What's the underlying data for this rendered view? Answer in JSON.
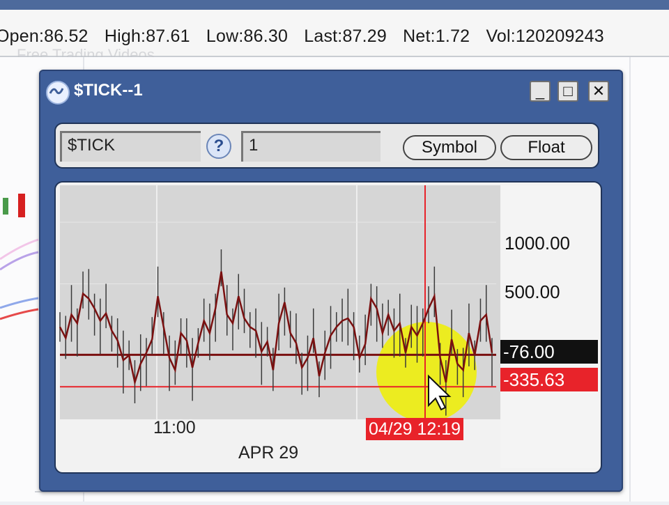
{
  "quote": {
    "open": "Open:86.52",
    "high": "High:87.61",
    "low": "Low:86.30",
    "last": "Last:87.29",
    "net": "Net:1.72",
    "vol": "Vol:120209243"
  },
  "watermark": "Free Trading Videos",
  "window": {
    "title": "$TICK--1",
    "min_label": "_",
    "max_label": "□",
    "close_label": "✕"
  },
  "toolbar": {
    "symbol_value": "$TICK",
    "help_label": "?",
    "interval_value": "1",
    "symbol_button": "Symbol",
    "float_button": "Float"
  },
  "chart": {
    "y_ticks": [
      "1000.00",
      "500.00"
    ],
    "last_tag": "-76.00",
    "crosshair_tag": "-335.63",
    "x_tick_1100": "11:00",
    "date_label": "APR 29",
    "crosshair_time": "04/29 12:19"
  },
  "colors": {
    "titlebar": "#3f5f9a",
    "price_line": "#7a1010",
    "crosshair": "#e8232a",
    "highlight": "#f0f000",
    "last_tag_bg": "#111111"
  },
  "chart_data": {
    "type": "line",
    "title": "$TICK",
    "xlabel": "",
    "ylabel": "",
    "ylim": [
      -600,
      1300
    ],
    "x_labels": [
      "11:00",
      "APR 29"
    ],
    "last_value": -76.0,
    "crosshair_value": -335.63,
    "crosshair_time": "04/29 12:19",
    "values": [
      150,
      60,
      250,
      180,
      420,
      380,
      300,
      200,
      260,
      120,
      40,
      -120,
      -80,
      -300,
      -150,
      -60,
      50,
      400,
      150,
      -100,
      -200,
      100,
      40,
      -180,
      20,
      200,
      100,
      300,
      600,
      250,
      180,
      400,
      220,
      150,
      120,
      -50,
      30,
      -200,
      180,
      350,
      100,
      20,
      -180,
      -100,
      60,
      -250,
      -60,
      80,
      150,
      200,
      220,
      150,
      -100,
      10,
      380,
      300,
      100,
      250,
      120,
      180,
      -60,
      150,
      80,
      180,
      300,
      400,
      -100,
      -300,
      50,
      -150,
      -200,
      100,
      -80,
      200,
      250,
      -60
    ]
  }
}
